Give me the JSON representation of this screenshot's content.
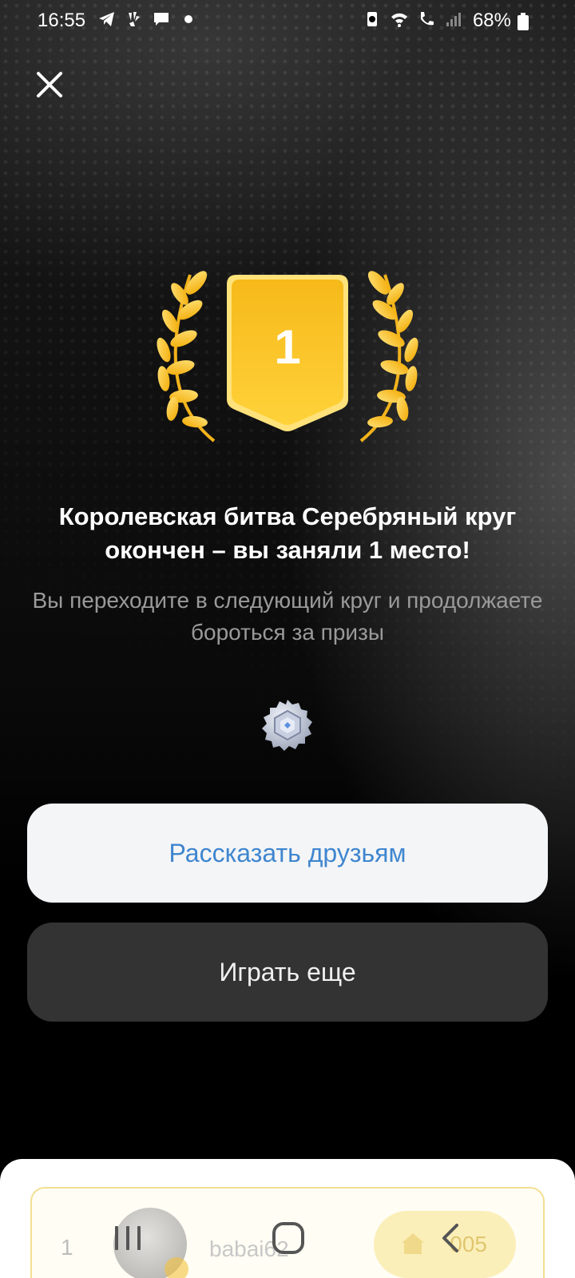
{
  "status_bar": {
    "time": "16:55",
    "battery": "68%",
    "icons_left": [
      "telegram-icon",
      "pinwheel-icon",
      "chat-bubble-icon",
      "dot-icon"
    ],
    "icons_right": [
      "recycle-icon",
      "wifi-icon",
      "volte-call-icon",
      "signal-icon",
      "battery-icon"
    ]
  },
  "header": {
    "close_icon": "close-icon"
  },
  "award": {
    "place_number": "1",
    "colors": {
      "gold": "#f5b800",
      "gold_light": "#ffd84a"
    }
  },
  "result": {
    "title": "Королевская битва Серебряный круг окончен – вы заняли 1 место!",
    "subtitle": "Вы переходите в следующий круг и продолжаете бороться за призы"
  },
  "league_badge_icon": "silver-league-badge-icon",
  "actions": {
    "share_label": "Рассказать друзьям",
    "play_again_label": "Играть еще"
  },
  "leaderboard": {
    "row": {
      "rank": "1",
      "name": "babai62",
      "score": "005"
    }
  },
  "nav_bar": {
    "recents_icon": "recents-icon",
    "home_icon": "home-icon",
    "back_icon": "back-icon"
  },
  "colors": {
    "accent_blue": "#3f86cf",
    "background": "#000000",
    "button_dark": "#333333"
  }
}
